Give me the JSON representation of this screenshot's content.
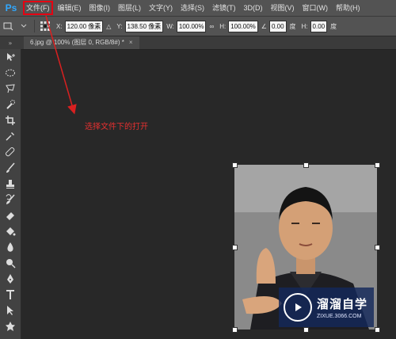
{
  "app": {
    "logo": "Ps"
  },
  "menu": [
    {
      "label": "文件(F)",
      "highlighted": true
    },
    {
      "label": "编辑(E)"
    },
    {
      "label": "图像(I)"
    },
    {
      "label": "图层(L)"
    },
    {
      "label": "文字(Y)"
    },
    {
      "label": "选择(S)"
    },
    {
      "label": "滤镜(T)"
    },
    {
      "label": "3D(D)"
    },
    {
      "label": "视图(V)"
    },
    {
      "label": "窗口(W)"
    },
    {
      "label": "帮助(H)"
    }
  ],
  "options": {
    "x_label": "X:",
    "x_value": "120.00 像素",
    "y_label": "Y:",
    "y_value": "138.50 像素",
    "w_label": "W:",
    "w_value": "100.00%",
    "h_label": "H:",
    "h_value": "100.00%",
    "angle_value": "0.00",
    "angle_unit": "度",
    "hskew_label": "H:",
    "hskew_value": "0.00",
    "hskew_unit": "度"
  },
  "document": {
    "tab_title": "6.jpg @ 100% (图层 0, RGB/8#) *",
    "close_symbol": "×"
  },
  "annotation": {
    "text": "选择文件下的打开",
    "color": "#e53030"
  },
  "tools": [
    "move-tool",
    "marquee-tool",
    "lasso-tool",
    "quick-select-tool",
    "crop-tool",
    "eyedropper-tool",
    "healing-brush-tool",
    "brush-tool",
    "clone-stamp-tool",
    "history-brush-tool",
    "eraser-tool",
    "paint-bucket-tool",
    "blur-tool",
    "dodge-tool",
    "pen-tool",
    "type-tool",
    "path-select-tool",
    "shape-tool"
  ],
  "watermark": {
    "title": "溜溜自学",
    "subtitle": "ZIXUE.3066.COM"
  },
  "colors": {
    "highlight": "#e60012",
    "accent": "#31a8ff"
  }
}
